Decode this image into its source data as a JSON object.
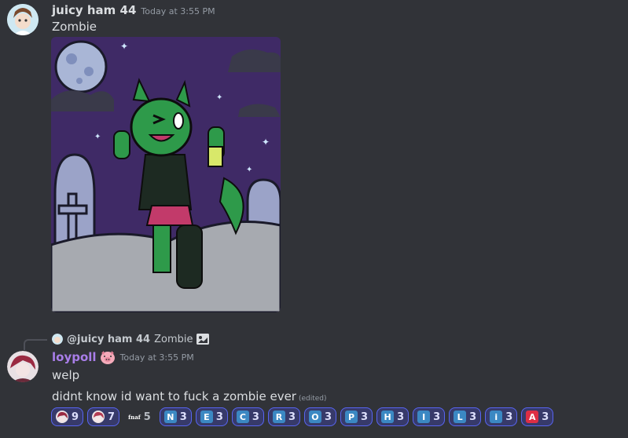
{
  "message1": {
    "username": "juicy ham 44",
    "username_color": "#dbdee1",
    "timestamp": "Today at 3:55 PM",
    "text": "Zombie"
  },
  "message2": {
    "reply": {
      "username": "@juicy ham 44",
      "text": "Zombie",
      "attachment_icon": "image-icon"
    },
    "username": "loypoll",
    "username_color": "#a97ee9",
    "badge_icon": "pig-face-icon",
    "timestamp": "Today at 3:55 PM",
    "lines": [
      "welp",
      "didnt know id want to fuck a zombie ever"
    ],
    "edited_label": "(edited)"
  },
  "reactions": [
    {
      "emoji": "avatar-emoji-1",
      "count": "9",
      "reacted": true
    },
    {
      "emoji": "avatar-emoji-2",
      "count": "7",
      "reacted": true
    },
    {
      "emoji": "text-emoji",
      "emoji_text": "fnaf",
      "count": "5",
      "reacted": false
    },
    {
      "emoji": "regional-n",
      "letter": "N",
      "count": "3",
      "reacted": true
    },
    {
      "emoji": "regional-e",
      "letter": "E",
      "count": "3",
      "reacted": true
    },
    {
      "emoji": "regional-c",
      "letter": "C",
      "count": "3",
      "reacted": true
    },
    {
      "emoji": "regional-r",
      "letter": "R",
      "count": "3",
      "reacted": true
    },
    {
      "emoji": "regional-o",
      "letter": "O",
      "count": "3",
      "reacted": true
    },
    {
      "emoji": "regional-p",
      "letter": "P",
      "count": "3",
      "reacted": true
    },
    {
      "emoji": "regional-h",
      "letter": "H",
      "count": "3",
      "reacted": true
    },
    {
      "emoji": "regional-i",
      "letter": "I",
      "count": "3",
      "reacted": true
    },
    {
      "emoji": "regional-l",
      "letter": "L",
      "count": "3",
      "reacted": true
    },
    {
      "emoji": "info-i",
      "letter": "i",
      "count": "3",
      "reacted": true
    },
    {
      "emoji": "blood-type-a",
      "letter": "A",
      "count": "3",
      "reacted": true,
      "red": true
    }
  ]
}
